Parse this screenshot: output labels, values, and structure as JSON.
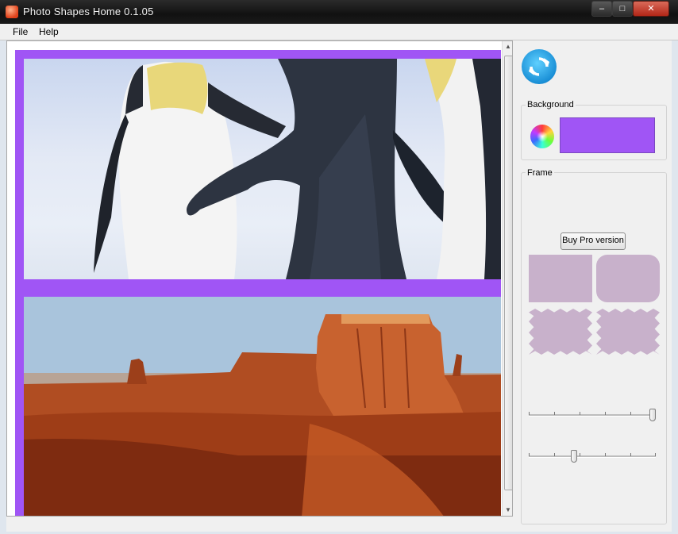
{
  "window": {
    "title": "Photo Shapes Home 0.1.05",
    "minimize_glyph": "‒",
    "maximize_glyph": "□",
    "close_glyph": "✕"
  },
  "menu": {
    "items": [
      {
        "label": "File"
      },
      {
        "label": "Help"
      }
    ]
  },
  "canvas": {
    "background_color": "#a055f5",
    "photos": [
      {
        "subject": "penguins",
        "icon": "penguins-photo"
      },
      {
        "subject": "desert mesa",
        "icon": "desert-photo"
      }
    ]
  },
  "side_panel": {
    "refresh_icon": "refresh-icon",
    "background": {
      "label": "Background",
      "color_wheel_icon": "color-wheel-icon",
      "swatch_color": "#a055f5"
    },
    "frame": {
      "label": "Frame",
      "buy_button_label": "Buy Pro version",
      "shapes": [
        "rectangle",
        "rounded-rectangle",
        "wavy-frame",
        "wavy-frame"
      ],
      "shape_color": "#c8b1cb"
    },
    "sliders": [
      {
        "name": "frame-size",
        "value": 1.0
      },
      {
        "name": "frame-detail",
        "value": 0.35
      }
    ]
  }
}
